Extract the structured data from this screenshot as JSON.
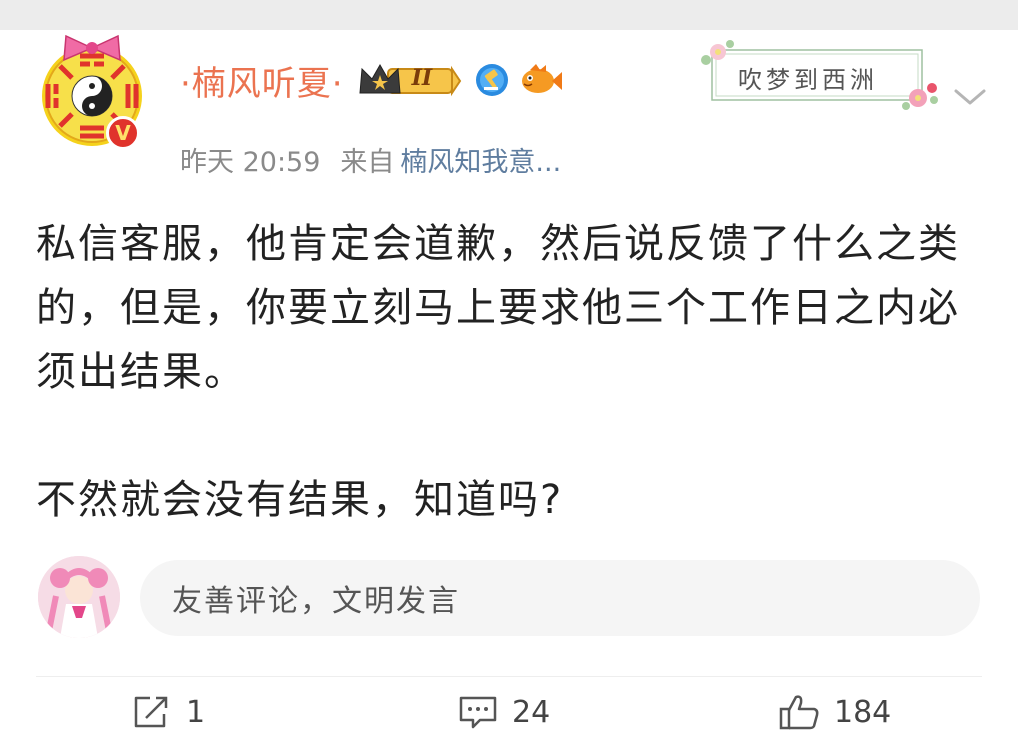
{
  "post": {
    "username": "·楠风听夏·",
    "vip_level": "II",
    "timestamp": "昨天 20:59",
    "source_prefix": "来自",
    "source": "楠风知我意...",
    "sticker_text": "吹梦到西洲",
    "content": [
      "私信客服，他肯定会道歉，然后说反馈了什么之类的，但是，你要立刻马上要求他三个工作日之内必须出结果。",
      "不然就会没有结果，知道吗?"
    ]
  },
  "comment_input": {
    "placeholder": "友善评论，文明发言"
  },
  "actions": {
    "repost_count": "1",
    "comment_count": "24",
    "like_count": "184"
  },
  "colors": {
    "username": "#eb7350",
    "source_link": "#5f7d9f",
    "verified": "#e0332c"
  }
}
